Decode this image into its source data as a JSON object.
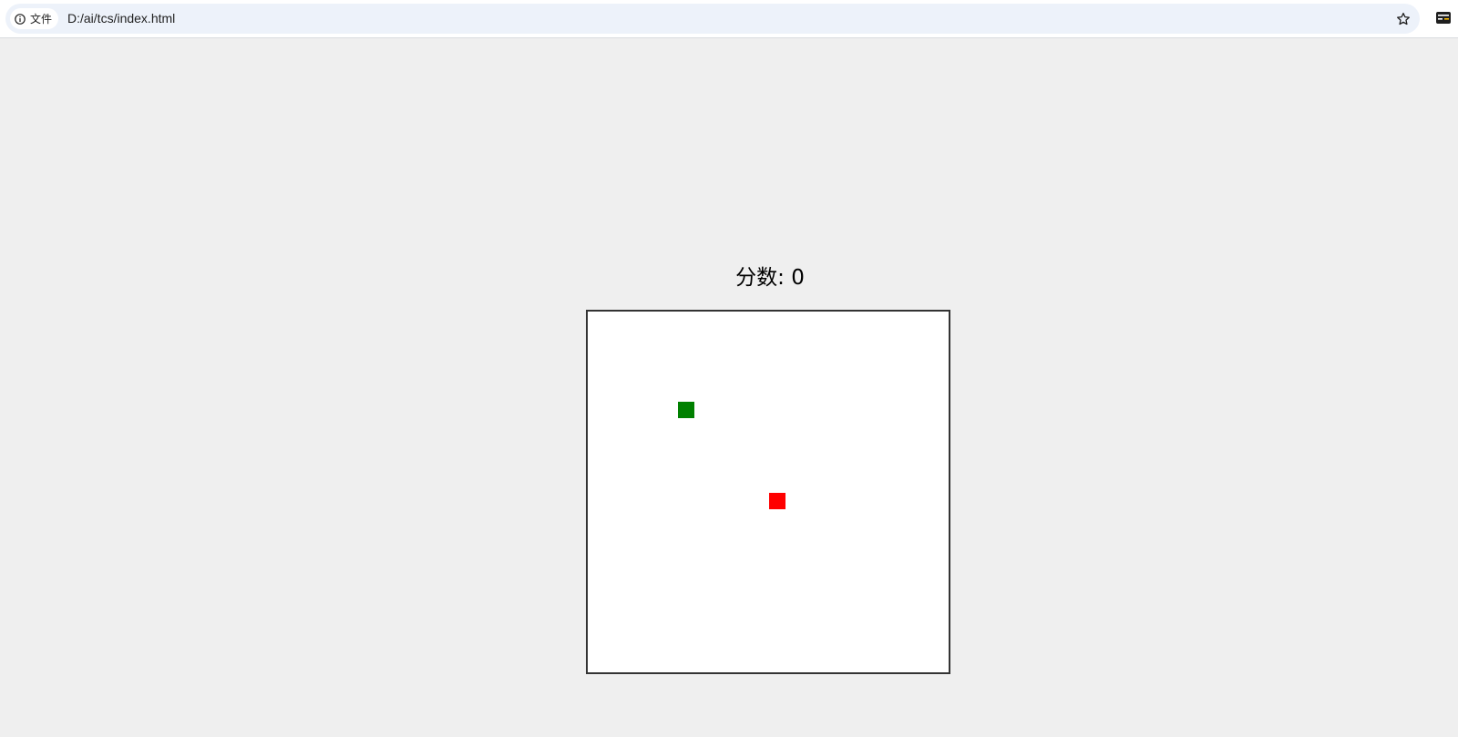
{
  "browser": {
    "site_chip_label": "文件",
    "url": "D:/ai/tcs/index.html",
    "icons": [
      "info-icon",
      "star-icon",
      "extension-icon"
    ]
  },
  "game": {
    "score_label": "分数: 0",
    "score": 0,
    "grid": {
      "cols": 20,
      "rows": 20
    },
    "snake": [
      {
        "col": 5,
        "row": 5
      }
    ],
    "food": {
      "col": 10,
      "row": 10
    },
    "colors": {
      "snake": "#008000",
      "food": "#ff0000",
      "board_background": "#ffffff",
      "board_border": "#333333",
      "page_background": "#efefef"
    }
  }
}
